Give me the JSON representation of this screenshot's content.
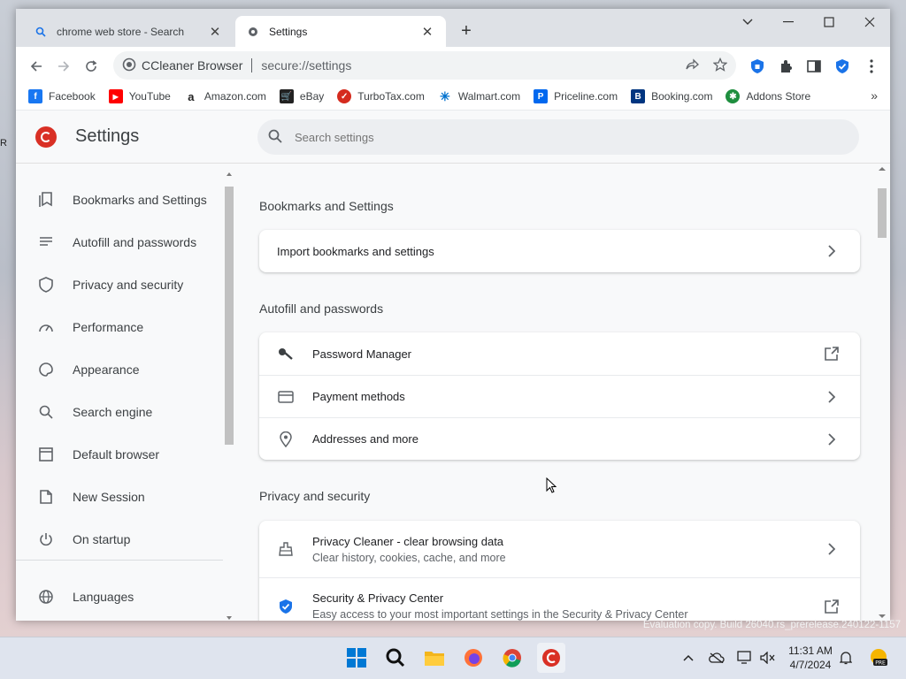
{
  "tabs": [
    {
      "title": "chrome web store - Search"
    },
    {
      "title": "Settings"
    }
  ],
  "omnibox": {
    "brand": "CCleaner Browser",
    "url": "secure://settings"
  },
  "bookmarks": [
    {
      "label": "Facebook",
      "color": "#1877f2",
      "glyph": "f"
    },
    {
      "label": "YouTube",
      "color": "#ff0000",
      "glyph": "▶"
    },
    {
      "label": "Amazon.com",
      "color": "#222222",
      "glyph": "a"
    },
    {
      "label": "eBay",
      "color": "#e53238",
      "glyph": "e"
    },
    {
      "label": "TurboTax.com",
      "color": "#d52b1e",
      "glyph": "✓"
    },
    {
      "label": "Walmart.com",
      "color": "#0071ce",
      "glyph": "✳"
    },
    {
      "label": "Priceline.com",
      "color": "#0068ef",
      "glyph": "P"
    },
    {
      "label": "Booking.com",
      "color": "#003580",
      "glyph": "B"
    },
    {
      "label": "Addons Store",
      "color": "#1e8e3e",
      "glyph": "✱"
    }
  ],
  "settings": {
    "title": "Settings",
    "search_placeholder": "Search settings"
  },
  "sidebar": {
    "items": [
      {
        "label": "Bookmarks and Settings",
        "icon": "bookmark-icon"
      },
      {
        "label": "Autofill and passwords",
        "icon": "list-icon"
      },
      {
        "label": "Privacy and security",
        "icon": "shield-icon"
      },
      {
        "label": "Performance",
        "icon": "speedometer-icon"
      },
      {
        "label": "Appearance",
        "icon": "palette-icon"
      },
      {
        "label": "Search engine",
        "icon": "search-icon"
      },
      {
        "label": "Default browser",
        "icon": "browser-icon"
      },
      {
        "label": "New Session",
        "icon": "new-session-icon"
      },
      {
        "label": "On startup",
        "icon": "power-icon"
      },
      {
        "label": "Languages",
        "icon": "globe-icon"
      }
    ]
  },
  "sections": {
    "bookmarks": {
      "title": "Bookmarks and Settings",
      "import": "Import bookmarks and settings"
    },
    "autofill": {
      "title": "Autofill and passwords",
      "password_manager": "Password Manager",
      "payment_methods": "Payment methods",
      "addresses": "Addresses and more"
    },
    "privacy": {
      "title": "Privacy and security",
      "cleaner_title": "Privacy Cleaner - clear browsing data",
      "cleaner_sub": "Clear history, cookies, cache, and more",
      "center_title": "Security & Privacy Center",
      "center_sub": "Easy access to your most important settings in the Security & Privacy Center"
    }
  },
  "taskbar": {
    "eval_text": "Evaluation copy. Build 26040.rs_prerelease.240122-1157",
    "time": "11:31 AM",
    "date": "4/7/2024"
  }
}
